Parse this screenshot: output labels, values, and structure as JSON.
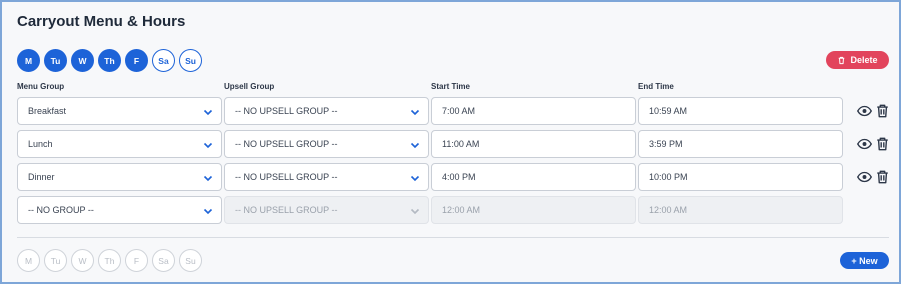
{
  "title": "Carryout Menu & Hours",
  "days_top": [
    {
      "label": "M",
      "selected": true
    },
    {
      "label": "Tu",
      "selected": true
    },
    {
      "label": "W",
      "selected": true
    },
    {
      "label": "Th",
      "selected": true
    },
    {
      "label": "F",
      "selected": true
    },
    {
      "label": "Sa",
      "selected": false
    },
    {
      "label": "Su",
      "selected": false
    }
  ],
  "days_bottom": [
    "M",
    "Tu",
    "W",
    "Th",
    "F",
    "Sa",
    "Su"
  ],
  "delete_label": "Delete",
  "new_label": "+ New",
  "columns": {
    "menu_group": "Menu Group",
    "upsell_group": "Upsell Group",
    "start_time": "Start Time",
    "end_time": "End Time"
  },
  "rows": [
    {
      "menu_group": "Breakfast",
      "upsell_group": "-- NO UPSELL GROUP --",
      "start_time": "7:00 AM",
      "end_time": "10:59 AM"
    },
    {
      "menu_group": "Lunch",
      "upsell_group": "-- NO UPSELL GROUP --",
      "start_time": "11:00 AM",
      "end_time": "3:59 PM"
    },
    {
      "menu_group": "Dinner",
      "upsell_group": "-- NO UPSELL GROUP --",
      "start_time": "4:00 PM",
      "end_time": "10:00 PM"
    }
  ],
  "new_row": {
    "menu_group": "-- NO GROUP --",
    "upsell_group": "-- NO UPSELL GROUP --",
    "start_time": "12:00 AM",
    "end_time": "12:00 AM"
  },
  "colors": {
    "accent": "#1d63d8",
    "danger": "#e2445c"
  }
}
